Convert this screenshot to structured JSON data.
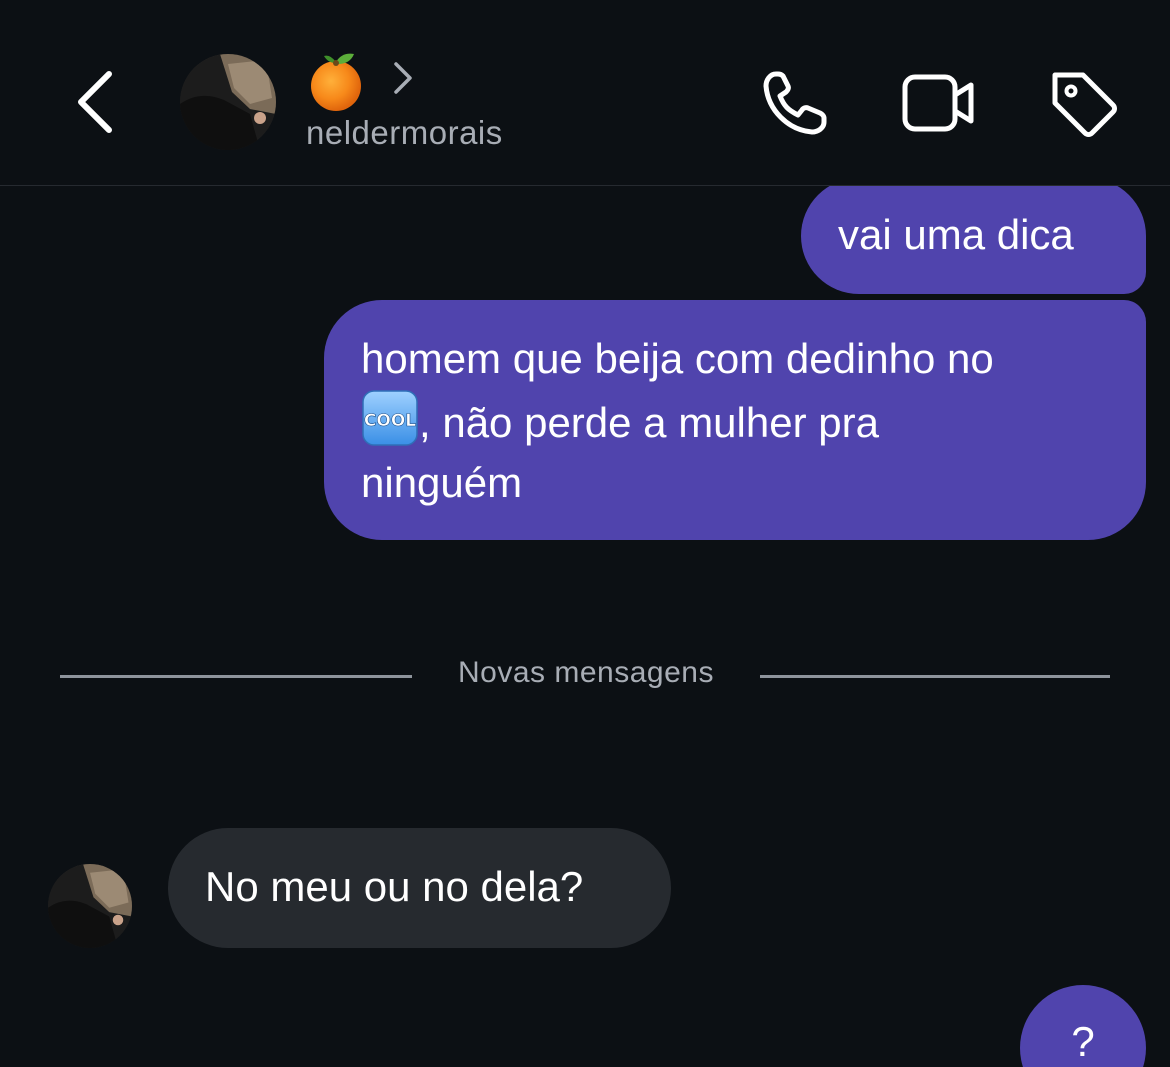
{
  "header": {
    "back_icon": "chevron-left-icon",
    "contact_emoji": "orange-emoji",
    "username": "neldermorais",
    "actions": [
      "phone-icon",
      "video-camera-icon",
      "tag-icon"
    ]
  },
  "messages": [
    {
      "direction": "outgoing",
      "text": "vai uma dica"
    },
    {
      "direction": "outgoing",
      "text_line1": "homem que beija com dedinho no",
      "emoji": "cool-emoji",
      "text_line2": ", não perde a mulher pra",
      "text_line3": "ninguém"
    },
    {
      "direction": "incoming",
      "text": "No meu ou no dela?"
    },
    {
      "direction": "outgoing",
      "text": "?"
    }
  ],
  "divider": {
    "label": "Novas mensagens"
  },
  "colors": {
    "background": "#0c1014",
    "outgoing_bubble": "#5044ad",
    "incoming_bubble": "#262a2f",
    "secondary_text": "#a8adb5"
  }
}
